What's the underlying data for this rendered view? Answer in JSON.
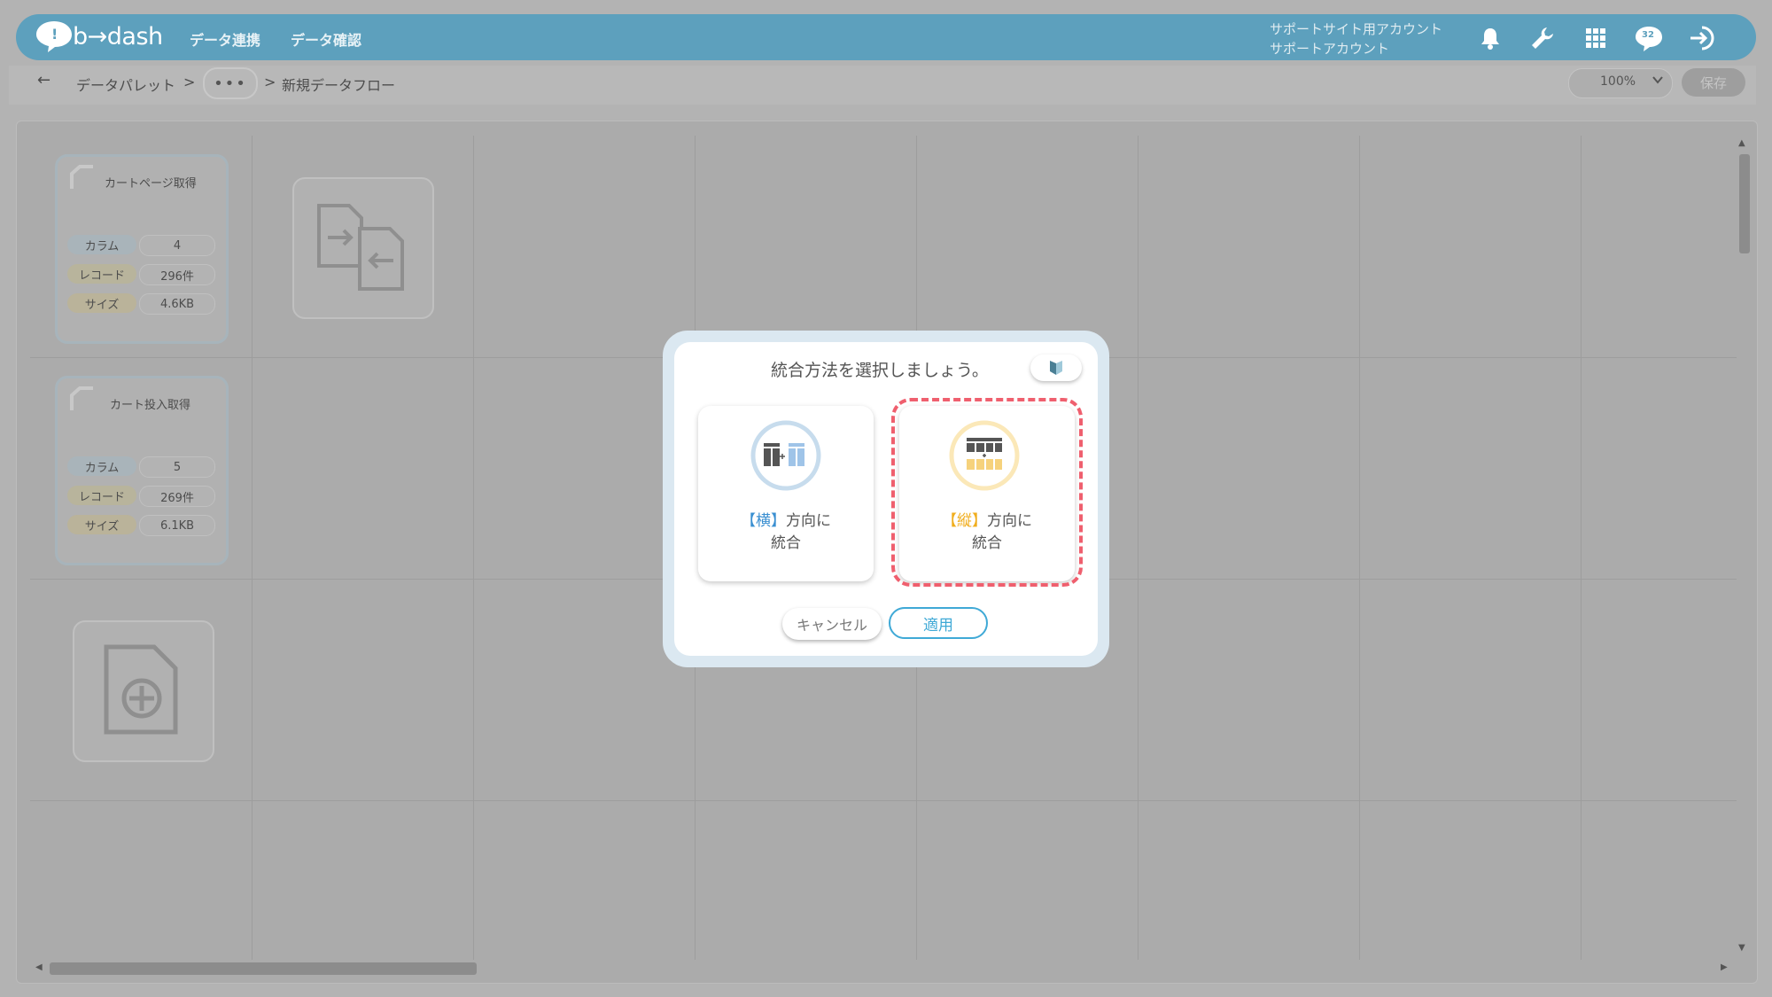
{
  "header": {
    "logo_text": "b→dash",
    "nav": [
      "データ連携",
      "データ確認"
    ],
    "account_line1": "サポートサイト用アカウント",
    "account_line2": "サポートアカウント",
    "badge_count": "32",
    "color": "#5da0bd"
  },
  "breadcrumb": {
    "back": "←",
    "root": "データパレット",
    "sep": ">",
    "dots": "•••",
    "current": "新規データフロー"
  },
  "toolbar": {
    "zoom": "100%",
    "save_label": "保存"
  },
  "nodes": [
    {
      "title": "カートページ取得",
      "column_label": "カラム",
      "column_value": "4",
      "record_label": "レコード",
      "record_value": "296件",
      "size_label": "サイズ",
      "size_value": "4.6KB"
    },
    {
      "title": "カート投入取得",
      "column_label": "カラム",
      "column_value": "5",
      "record_label": "レコード",
      "record_value": "269件",
      "size_label": "サイズ",
      "size_value": "6.1KB"
    }
  ],
  "dialog": {
    "title": "統合方法を選択しましょう。",
    "options": [
      {
        "bracket": "【横】",
        "text": "方向に",
        "text2": "統合",
        "accent": "#3a8fd1"
      },
      {
        "bracket": "【縦】",
        "text": "方向に",
        "text2": "統合",
        "accent": "#f0ad1c"
      }
    ],
    "selected_option": 1,
    "cancel_label": "キャンセル",
    "apply_label": "適用"
  }
}
